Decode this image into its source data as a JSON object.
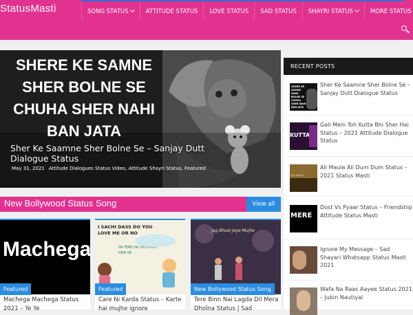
{
  "site": {
    "logo": "StatusMasti"
  },
  "nav": {
    "items": [
      {
        "label": "SONG STATUS",
        "dropdown": true
      },
      {
        "label": "ATTITUDE STATUS",
        "dropdown": false
      },
      {
        "label": "LOVE STATUS",
        "dropdown": false
      },
      {
        "label": "SAD STATUS",
        "dropdown": false
      },
      {
        "label": "SHAYRI STATUS",
        "dropdown": true
      },
      {
        "label": "MORE STATUS",
        "dropdown": true
      }
    ],
    "search_icon": "search-icon"
  },
  "feature": {
    "image_lines": [
      "SHERE KE SAMNE",
      "SHER BOLNE SE",
      "CHUHA SHER NAHI",
      "BAN JATA"
    ],
    "title": "Sher Ke Saamne Sher Bolne Se – Sanjay Dutt Dialogue Status",
    "date": "May 31, 2021",
    "categories": "Attitude Dialogues Status Video, Attitude Shayri Status, Featured"
  },
  "section": {
    "title": "New Bollywood Status Song",
    "view_all": "View all"
  },
  "cards": [
    {
      "thumb_text": "Machega",
      "badge": "Featured",
      "title": "Machega Machega Status 2021 – Ye Ye"
    },
    {
      "thumb_text": "I SACHI DASS DO YOU LOVE ME OR NO",
      "thumb_sub": "YA TERE DIL VICH KOYI HOR VE",
      "badge": "Featured",
      "title": "Care Ni Karda Status – Karte hai mujhe ignore"
    },
    {
      "thumb_text": "Jag Bhool Jaye Mujhe",
      "badge": "New Bollywood Status Song",
      "title": "Tere Binn Nai Lagda Dil Mera Dholna Status | Sad"
    }
  ],
  "sidebar": {
    "heading": "RECENT POSTS",
    "posts": [
      {
        "thumb_text": "SHERE KE SAMNE SHER BOLNE SE CHUHA SHER NAHI BAN JATA",
        "title": "Sher Ke Saamne Sher Bolne Se – Sanjay Dutt Dialogue Status"
      },
      {
        "thumb_text": "KUTTA",
        "title": "Gali Mein Toh Kutta Bhi Sher Hai Status – 2021 Attitude Dialogue Status"
      },
      {
        "thumb_text": "ALI MAULA",
        "title": "Ali Maula Ali Dum Dum Status – 2021 Status Masti"
      },
      {
        "thumb_text": "MERE",
        "title": "Dost Vs Pyaar Status – Friendship Attitude Status Masti"
      },
      {
        "thumb_text": "",
        "title": "Ignore My Message – Sad Shayari Whatsapp Status Masti 2021"
      },
      {
        "thumb_text": "",
        "title": "Wafa Na Raas Aayee Status 2021 – Jubin Nautiyal"
      }
    ]
  },
  "colors": {
    "brand": "#e2328f",
    "accent": "#2b8de0",
    "dark": "#1a1a1a"
  }
}
